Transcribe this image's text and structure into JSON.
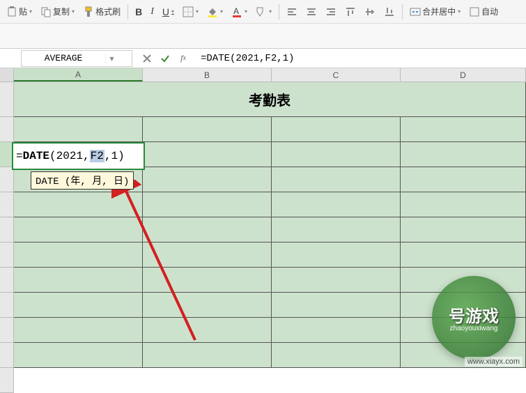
{
  "toolbar": {
    "paste_label": "贴",
    "copy_label": "复制",
    "format_painter_label": "格式刷",
    "merge_center_label": "合并居中",
    "auto_label": "自动",
    "bold": "B",
    "italic": "I",
    "underline": "U"
  },
  "formula_bar": {
    "name_box_value": "AVERAGE",
    "formula_value": "=DATE(2021,F2,1)"
  },
  "columns": [
    "A",
    "B",
    "C",
    "D"
  ],
  "sheet": {
    "title_text": "考勤表",
    "active_cell_formula_parts": {
      "prefix": "=",
      "fn": "DATE",
      "open": "(",
      "arg1": "2021",
      "sep1": ",",
      "arg2": "F2",
      "sep2": ",",
      "arg3": "1",
      "close": ")"
    },
    "tooltip_text": "DATE (年, 月, 日)"
  },
  "watermark": {
    "main": "号游戏",
    "sub": "zhaoyouxiwang",
    "url": "www.xiayx.com"
  }
}
